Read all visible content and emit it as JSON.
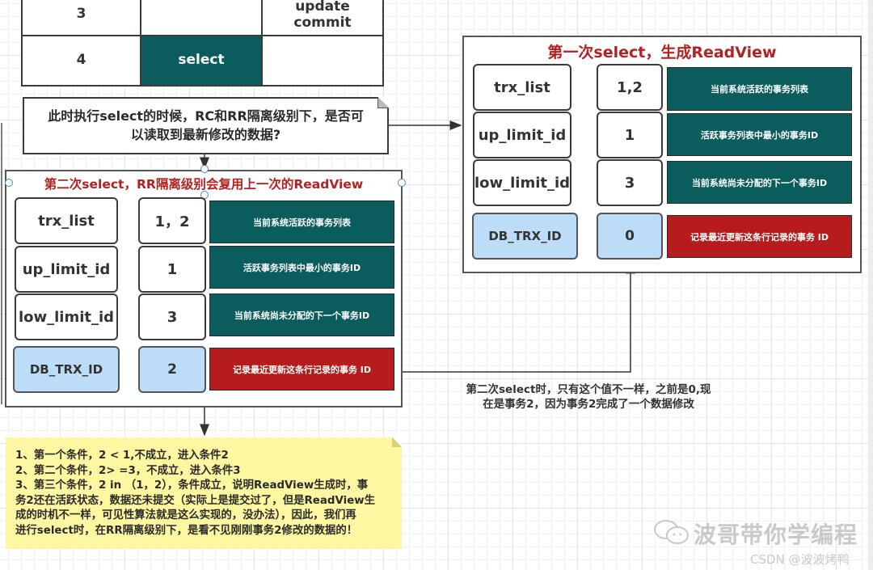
{
  "table": {
    "rows": [
      {
        "step": "3",
        "t1": "",
        "t2": "update\ncommit"
      },
      {
        "step": "4",
        "t1": "select",
        "t2": ""
      }
    ]
  },
  "question_note": {
    "line1": "此时执行select的时候，RC和RR隔离级别下，是否可",
    "line2": "以读取到最新修改的数据?"
  },
  "first_readview": {
    "title": "第一次select，生成ReadView",
    "rows": [
      {
        "field": "trx_list",
        "value": "1,2",
        "desc": "当前系统活跃的事务列表",
        "style": "teal"
      },
      {
        "field": "up_limit_id",
        "value": "1",
        "desc": "活跃事务列表中最小的事务ID",
        "style": "teal"
      },
      {
        "field": "low_limit_id",
        "value": "3",
        "desc": "当前系统尚未分配的下一个事务ID",
        "style": "teal"
      },
      {
        "field": "DB_TRX_ID",
        "value": "0",
        "desc": "记录最近更新这条行记录的事务 ID",
        "style": "red"
      }
    ]
  },
  "second_readview": {
    "title": "第二次select，RR隔离级别会复用上一次的ReadView",
    "rows": [
      {
        "field": "trx_list",
        "value": "1，2",
        "desc": "当前系统活跃的事务列表",
        "style": "teal"
      },
      {
        "field": "up_limit_id",
        "value": "1",
        "desc": "活跃事务列表中最小的事务ID",
        "style": "teal"
      },
      {
        "field": "low_limit_id",
        "value": "3",
        "desc": "当前系统尚未分配的下一个事务ID",
        "style": "teal"
      },
      {
        "field": "DB_TRX_ID",
        "value": "2",
        "desc": "记录最近更新这条行记录的事务 ID",
        "style": "red"
      }
    ]
  },
  "diff_annotation": {
    "line1": "第二次select时，只有这个值不一样，之前是0,现",
    "line2": "在是事务2，因为事务2完成了一个数据修改"
  },
  "conclusion_note": {
    "lines": [
      "1、第一个条件，2 < 1,不成立，进入条件2",
      "2、第二个条件，2> =3，不成立，进入条件3",
      "3、第三个条件，2 in （1，2），条件成立，说明ReadView生成时，事",
      "务2还在活跃状态，数据还未提交（实际上是提交过了，但是ReadView生",
      "成的时机不一样，可见性算法就是这么实现的，没办法），因此，我们再",
      "进行select时，在RR隔离级别下，是看不见刚刚事务2修改的数据的！"
    ]
  },
  "watermark": {
    "brand": "波哥带你学编程",
    "source": "CSDN @波波烤鸭"
  },
  "colors": {
    "teal": "#0b5c5c",
    "red": "#b71c1c",
    "blue": "#bcdcf7",
    "title_red": "#b22222",
    "note_yellow": "#fdf7a1"
  }
}
